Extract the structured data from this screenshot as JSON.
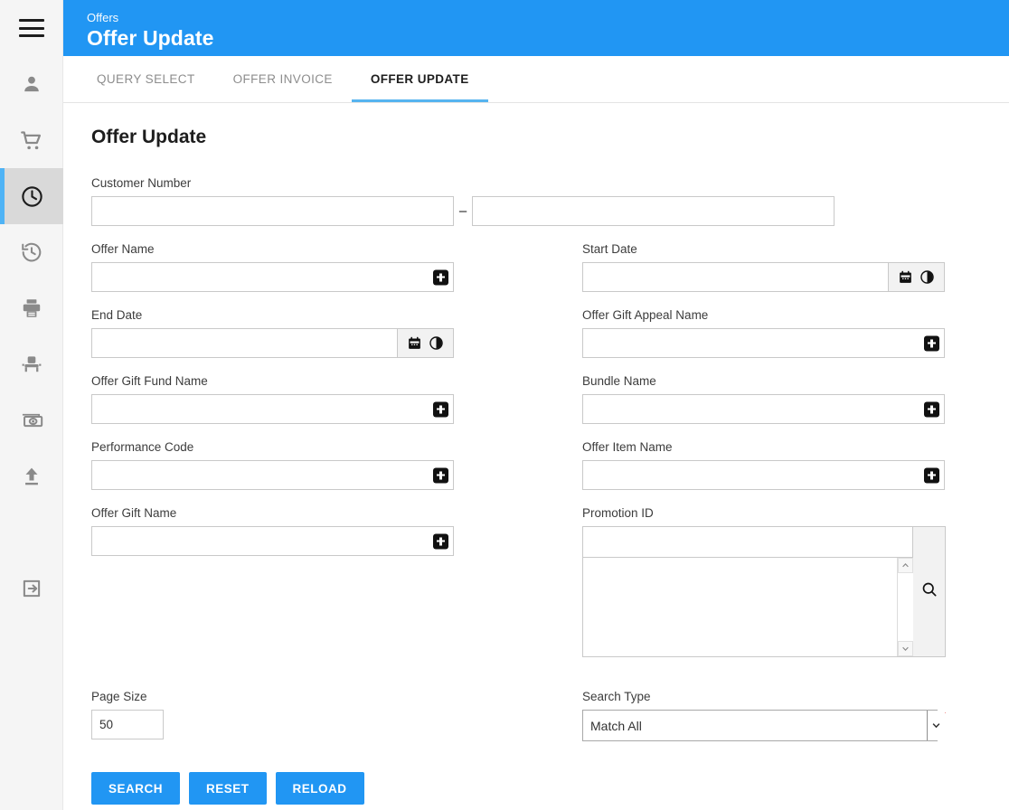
{
  "app": {
    "menu_icon": "hamburger-menu-icon"
  },
  "sidebar": {
    "items": [
      {
        "icon": "person-icon",
        "name": "customer",
        "active": false
      },
      {
        "icon": "shopping-cart-icon",
        "name": "orders",
        "active": false
      },
      {
        "icon": "clock-icon",
        "name": "offers",
        "active": true
      },
      {
        "icon": "history-icon",
        "name": "history",
        "active": false
      },
      {
        "icon": "printer-icon",
        "name": "print",
        "active": false
      },
      {
        "icon": "seat-icon",
        "name": "seating",
        "active": false
      },
      {
        "icon": "money-icon",
        "name": "payments",
        "active": false
      },
      {
        "icon": "upload-icon",
        "name": "upload",
        "active": false
      },
      {
        "icon": "logout-icon",
        "name": "logout",
        "active": false
      }
    ]
  },
  "header": {
    "kicker": "Offers",
    "title": "Offer Update",
    "background": "#2196f3"
  },
  "tabs": [
    {
      "label": "QUERY SELECT",
      "active": false
    },
    {
      "label": "OFFER INVOICE",
      "active": false
    },
    {
      "label": "OFFER UPDATE",
      "active": true
    }
  ],
  "main": {
    "page_title": "Offer Update",
    "fields": {
      "customer_number": {
        "label": "Customer Number",
        "from_value": "",
        "to_value": "",
        "separator": "–"
      },
      "offer_name": {
        "label": "Offer Name",
        "value": "",
        "action_icon": "plus-icon"
      },
      "start_date": {
        "label": "Start Date",
        "value": "",
        "calendar_icon": "calendar-icon",
        "time_icon": "clock-half-icon"
      },
      "end_date": {
        "label": "End Date",
        "value": "",
        "calendar_icon": "calendar-icon",
        "time_icon": "clock-half-icon"
      },
      "offer_gift_appeal_name": {
        "label": "Offer Gift Appeal Name",
        "value": "",
        "action_icon": "plus-icon"
      },
      "offer_gift_fund_name": {
        "label": "Offer Gift Fund Name",
        "value": "",
        "action_icon": "plus-icon"
      },
      "bundle_name": {
        "label": "Bundle Name",
        "value": "",
        "action_icon": "plus-icon"
      },
      "performance_code": {
        "label": "Performance Code",
        "value": "",
        "action_icon": "plus-icon"
      },
      "offer_item_name": {
        "label": "Offer Item Name",
        "value": "",
        "action_icon": "plus-icon"
      },
      "offer_gift_name": {
        "label": "Offer Gift Name",
        "value": "",
        "action_icon": "plus-icon"
      },
      "promotion_id": {
        "label": "Promotion ID",
        "value": "",
        "list_items": [],
        "search_icon": "magnifier-icon",
        "scroll_up_icon": "chevron-up-icon",
        "scroll_down_icon": "chevron-down-icon"
      },
      "page_size": {
        "label": "Page Size",
        "value": "50"
      },
      "search_type": {
        "label": "Search Type",
        "value": "Match All",
        "options": [
          "Match All"
        ],
        "required": true,
        "required_marker": "*",
        "arrow_icon": "chevron-down-icon"
      }
    },
    "buttons": [
      {
        "label": "SEARCH",
        "name": "search-button"
      },
      {
        "label": "RESET",
        "name": "reset-button"
      },
      {
        "label": "RELOAD",
        "name": "reload-button"
      }
    ]
  },
  "colors": {
    "accent": "#2196f3",
    "tab_underline": "#56b4f0",
    "rail_active_bg": "#d9d9d9",
    "required": "#e53935"
  }
}
